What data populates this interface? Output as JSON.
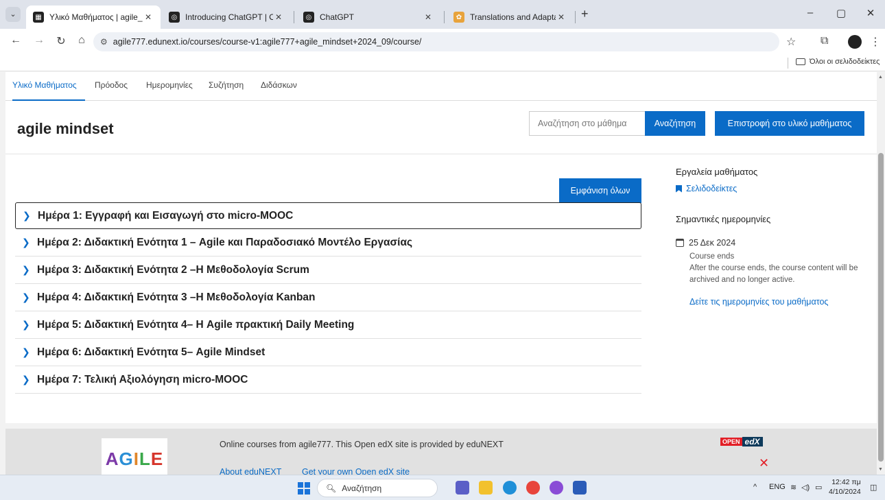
{
  "browser": {
    "tabs": [
      {
        "title": "Υλικό Μαθήματος | agile_mind:",
        "active": true
      },
      {
        "title": "Introducing ChatGPT | OpenAI",
        "active": false
      },
      {
        "title": "ChatGPT",
        "active": false
      },
      {
        "title": "Translations and Adaptations –",
        "active": false
      }
    ],
    "url": "agile777.edunext.io/courses/course-v1:agile777+agile_mindset+2024_09/course/",
    "bookmarks_folder": "Όλοι οι σελιδοδείκτες"
  },
  "course_nav": {
    "tabs": [
      "Υλικό Μαθήματος",
      "Πρόοδος",
      "Ημερομηνίες",
      "Συζήτηση",
      "Διδάσκων"
    ],
    "active_index": 0
  },
  "header": {
    "course_title": "agile mindset",
    "search_placeholder": "Αναζήτηση στο μάθημα",
    "search_button": "Αναζήτηση",
    "return_button": "Επιστροφή στο υλικό μαθήματος"
  },
  "outline": {
    "expand_all": "Εμφάνιση όλων",
    "sections": [
      "Ημέρα 1: Εγγραφή και Εισαγωγή στο micro-MOOC",
      "Ημέρα 2: Διδακτική Ενότητα 1 – Agile και Παραδοσιακό Μοντέλο Εργασίας",
      "Ημέρα 3: Διδακτική Ενότητα 2 –Η Μεθοδολογία Scrum",
      "Ημέρα 4: Διδακτική Ενότητα 3 –Η Μεθοδολογία Kanban",
      "Ημέρα 5: Διδακτική Ενότητα 4– Η Agile πρακτική Daily Meeting",
      "Ημέρα 6: Διδακτική Ενότητα 5– Agile Mindset",
      "Ημέρα 7: Τελική Αξιολόγηση micro-MOOC"
    ]
  },
  "sidebar": {
    "tools_heading": "Εργαλεία μαθήματος",
    "bookmarks_link": "Σελιδοδείκτες",
    "dates_heading": "Σημαντικές ημερομηνίες",
    "date": "25 Δεκ 2024",
    "date_label": "Course ends",
    "date_note": "After the course ends, the course content will be archived and no longer active.",
    "dates_link": "Δείτε τις ημερομηνίες του μαθήματος"
  },
  "footer": {
    "logo_text": "AGILE",
    "text": "Online courses from agile777. This Open edX site is provided by eduNEXT",
    "links": [
      "About eduNEXT",
      "Get your own Open edX site"
    ],
    "openedx_small": "OPEN",
    "openedx_big": "edX"
  },
  "taskbar": {
    "search": "Αναζήτηση",
    "lang": "ENG",
    "time": "12:42 πμ",
    "date": "4/10/2024"
  },
  "colors": {
    "accent": "#0a6bc7",
    "footer_bg": "#e1e1e1"
  }
}
